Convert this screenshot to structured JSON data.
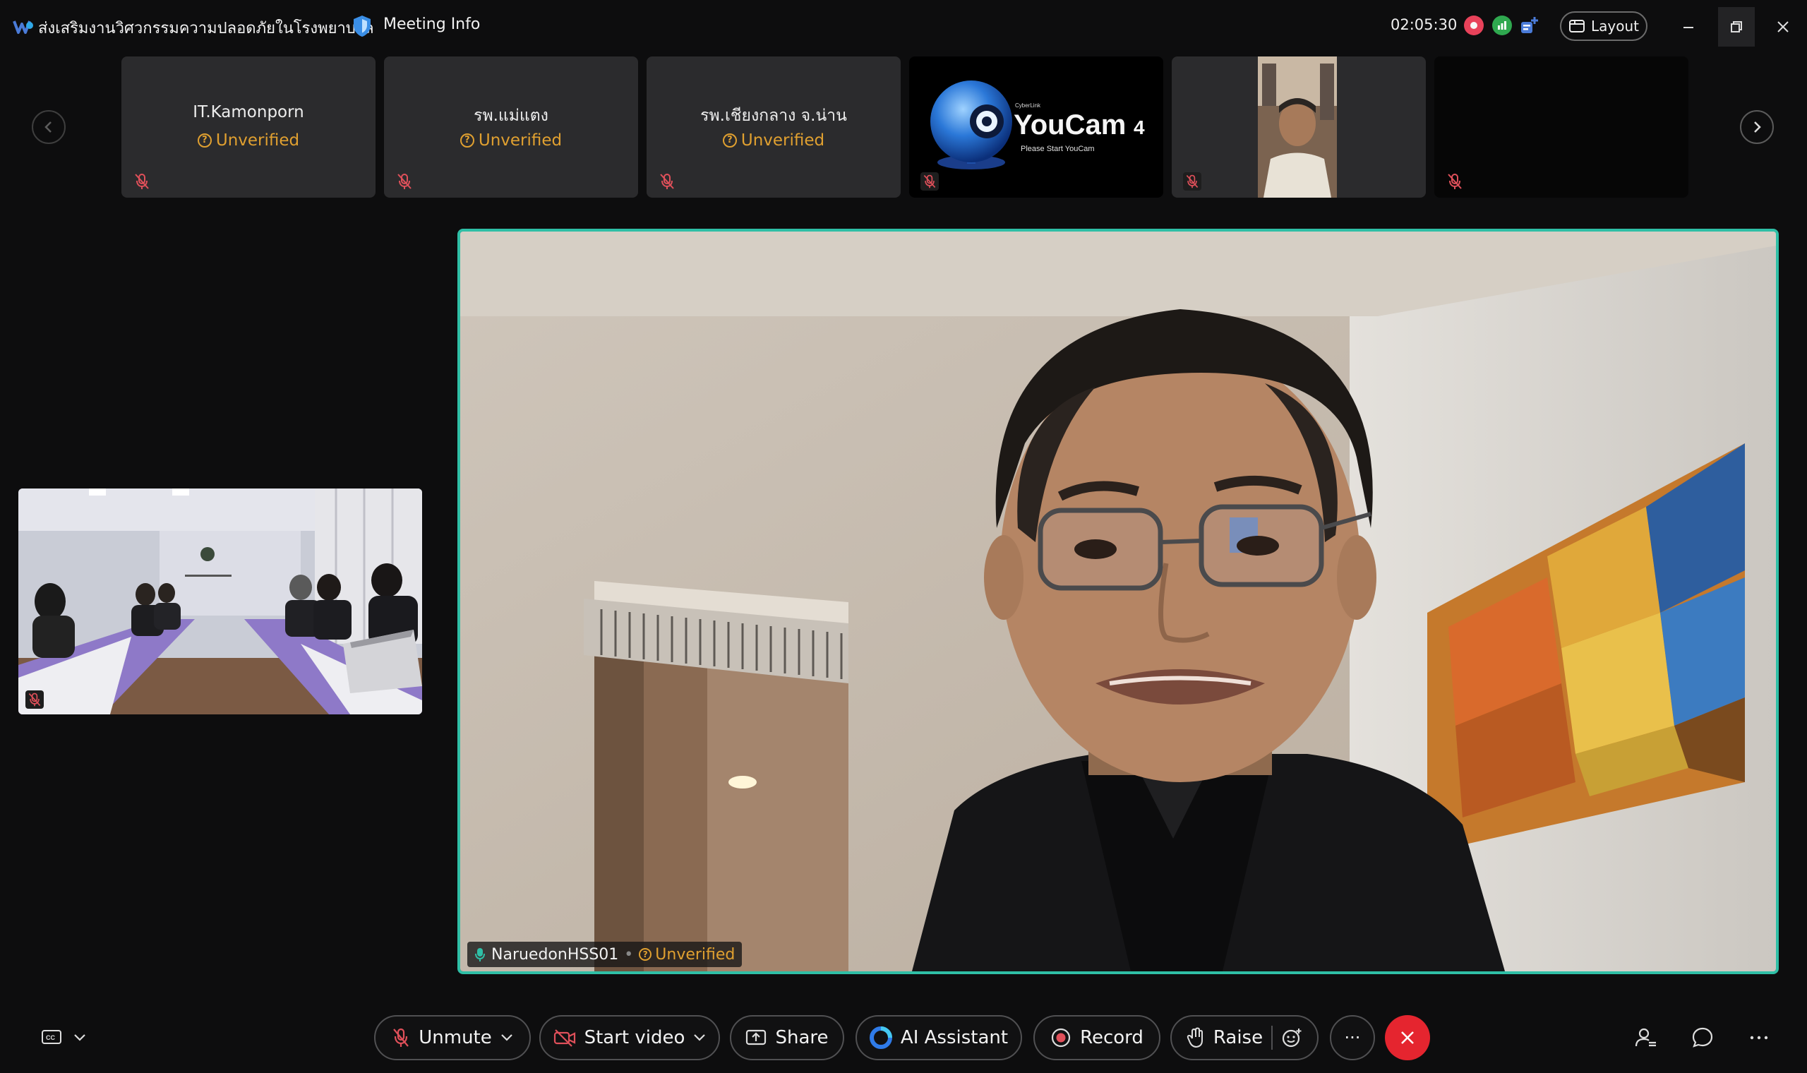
{
  "titlebar": {
    "meeting_title": "ส่งเสริมงานวิศวกรรมความปลอดภัยในโรงพยาบาล",
    "meeting_info_label": "Meeting Info",
    "timer": "02:05:30",
    "layout_label": "Layout",
    "colors": {
      "recording": "#e8425a",
      "network": "#2fa84f",
      "app_icon": "#4a7bd8"
    }
  },
  "filmstrip": {
    "tiles": [
      {
        "name": "IT.Kamonporn",
        "status": "Unverified",
        "muted": true
      },
      {
        "name": "รพ.แม่แตง",
        "status": "Unverified",
        "muted": true
      },
      {
        "name": "รพ.เชียงกลาง จ.น่าน",
        "status": "Unverified",
        "muted": true
      },
      {
        "name": "",
        "status": "",
        "muted": true,
        "video": "youcam-splash"
      },
      {
        "name": "",
        "status": "",
        "muted": true,
        "video": "camera-person"
      },
      {
        "name": "",
        "status": "",
        "muted": true,
        "video": "dark"
      }
    ],
    "youcam": {
      "brand_small": "CyberLink",
      "brand": "YouCam",
      "version": "4",
      "tagline": "Please Start YouCam"
    }
  },
  "main_video": {
    "participant_name": "NaruedonHSS01",
    "status": "Unverified",
    "active_speaker_color": "#2fbfa6"
  },
  "toolbar": {
    "unmute_label": "Unmute",
    "start_video_label": "Start video",
    "share_label": "Share",
    "ai_assistant_label": "AI Assistant",
    "record_label": "Record",
    "raise_label": "Raise",
    "more_label": "···",
    "leave_color": "#e5252f"
  }
}
